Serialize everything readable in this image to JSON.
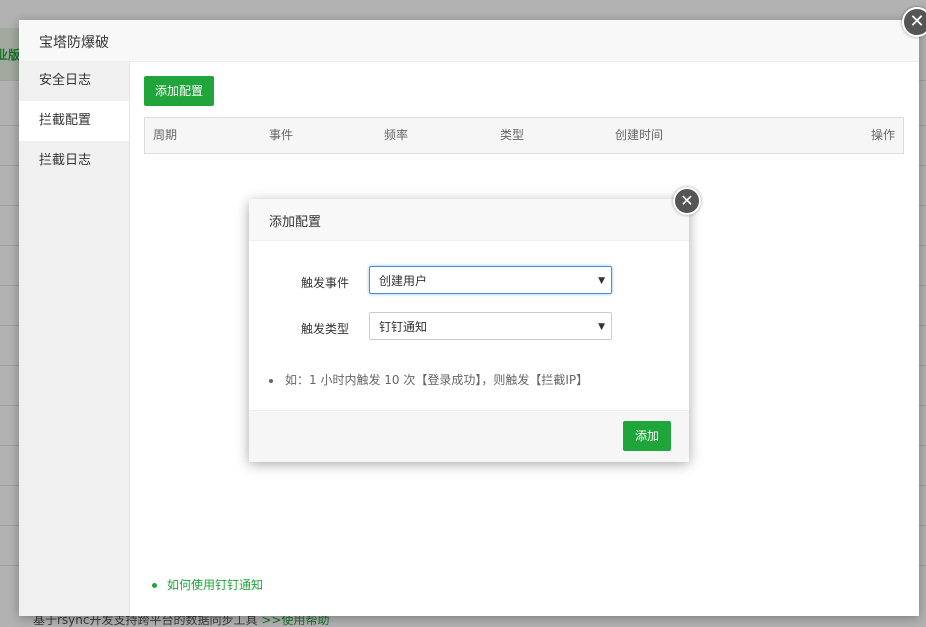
{
  "background": {
    "edge_label": "业版",
    "footer_text": "基于rsync开发支持跨平台的数据同步工具",
    "footer_link": ">>使用帮助"
  },
  "main_modal": {
    "title": "宝塔防爆破",
    "close_glyph": "✕",
    "sidebar": {
      "items": [
        {
          "label": "安全日志",
          "active": false
        },
        {
          "label": "拦截配置",
          "active": true
        },
        {
          "label": "拦截日志",
          "active": false
        }
      ]
    },
    "add_button_label": "添加配置",
    "table": {
      "columns": [
        "周期",
        "事件",
        "频率",
        "类型",
        "创建时间",
        "操作"
      ],
      "rows": []
    },
    "guide_link": "如何使用钉钉通知"
  },
  "dialog": {
    "title": "添加配置",
    "close_glyph": "✕",
    "fields": {
      "event": {
        "label": "触发事件",
        "value": "创建用户"
      },
      "type": {
        "label": "触发类型",
        "value": "钉钉通知"
      }
    },
    "hint": "如：1 小时内触发 10 次【登录成功】，则触发【拦截IP】",
    "submit_label": "添加"
  },
  "colors": {
    "accent": "#20a53a",
    "focus": "#4a90e2"
  }
}
